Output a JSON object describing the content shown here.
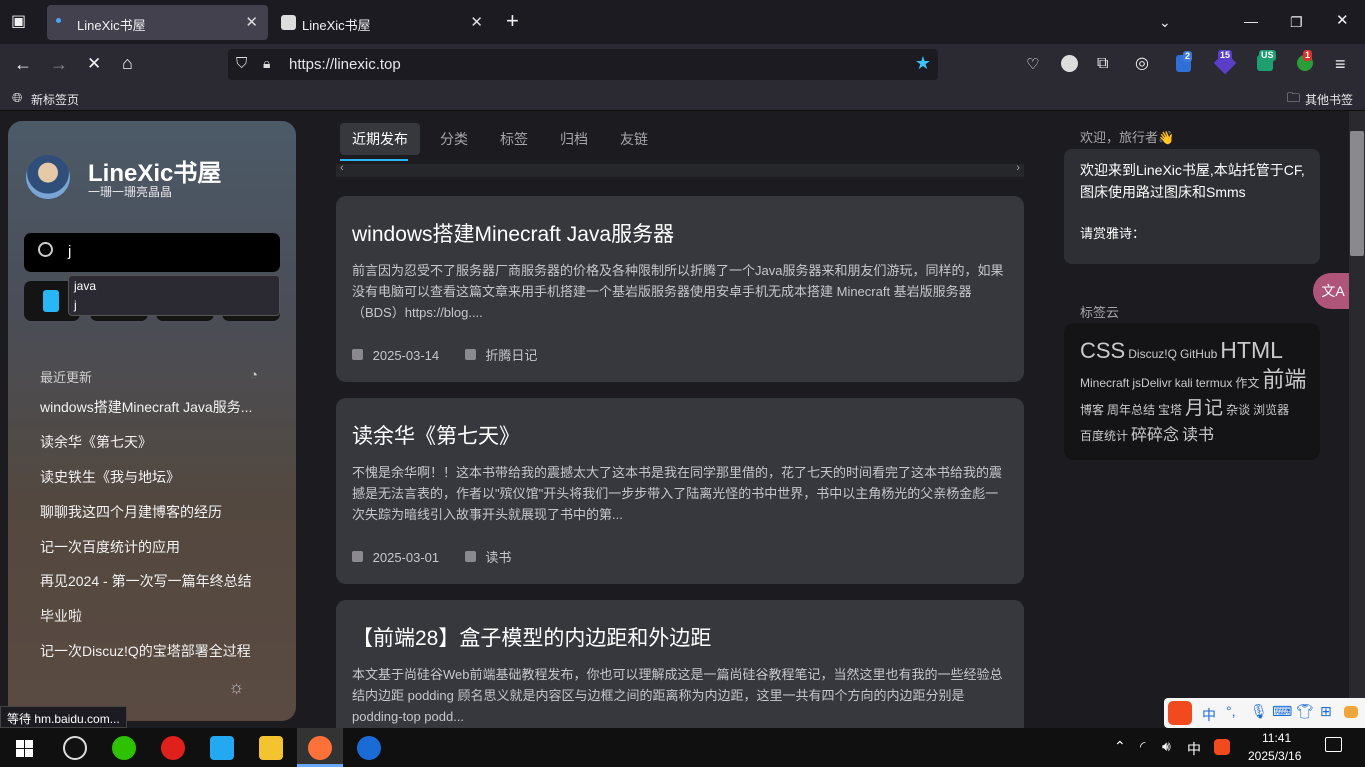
{
  "browser": {
    "tabs": [
      {
        "title": "LineXic书屋",
        "active": true
      },
      {
        "title": "LineXic书屋",
        "active": false
      }
    ],
    "new_tab": "+",
    "url": "https://linexic.top",
    "bookmarks": {
      "new_tab": "新标签页",
      "other": "其他书签"
    },
    "ext_badges": [
      "2",
      "15",
      "US",
      "1"
    ]
  },
  "sidebar": {
    "site_title": "LineXic书屋",
    "site_subtitle": "一珊一珊亮晶晶",
    "search_value": "j",
    "suggestions": [
      "java",
      "j"
    ],
    "recent_title": "最近更新",
    "recent_items": [
      "windows搭建Minecraft Java服务...",
      "读余华《第七天》",
      "读史铁生《我与地坛》",
      "聊聊我这四个月建博客的经历",
      "记一次百度统计的应用",
      "再见2024 - 第一次写一篇年终总结",
      "毕业啦",
      "记一次Discuz!Q的宝塔部署全过程"
    ]
  },
  "main": {
    "tabs": [
      "近期发布",
      "分类",
      "标签",
      "归档",
      "友链"
    ],
    "posts": [
      {
        "title": "windows搭建Minecraft Java服务器",
        "excerpt": "前言因为忍受不了服务器厂商服务器的价格及各种限制所以折腾了一个Java服务器来和朋友们游玩，同样的，如果没有电脑可以查看这篇文章来用手机搭建一个基岩版服务器使用安卓手机无成本搭建 Minecraft 基岩版服务器（BDS）https://blog....",
        "date": "2025-03-14",
        "category": "折腾日记"
      },
      {
        "title": "读余华《第七天》",
        "excerpt": "不愧是余华啊！！这本书带给我的震撼太大了这本书是我在同学那里借的，花了七天的时间看完了这本书给我的震撼是无法言表的，作者以\"殡仪馆\"开头将我们一步步带入了陆离光怪的书中世界，书中以主角杨光的父亲杨金彪一次失踪为暗线引入故事开头就展现了书中的第...",
        "date": "2025-03-01",
        "category": "读书"
      },
      {
        "title": "【前端28】盒子模型的内边距和外边距",
        "excerpt": "本文基于尚硅谷Web前端基础教程发布，你也可以理解成这是一篇尚硅谷教程笔记，当然这里也有我的一些经验总结内边距 podding 顾名思义就是内容区与边框之间的距离称为内边距，这里一共有四个方向的内边距分别是 podding-top podd..."
      }
    ]
  },
  "right": {
    "welcome_title": "欢迎，旅行者👋",
    "welcome_text": "欢迎来到LineXic书屋,本站托管于CF,图床使用路过图床和Smms",
    "poem_label": "请赏雅诗：",
    "tagcloud_title": "标签云",
    "tags": [
      {
        "name": "CSS",
        "size": 22
      },
      {
        "name": "Discuz!Q",
        "size": 12
      },
      {
        "name": "GitHub",
        "size": 12
      },
      {
        "name": "HTML",
        "size": 23
      },
      {
        "name": "Minecraft",
        "size": 12
      },
      {
        "name": "jsDelivr",
        "size": 12
      },
      {
        "name": "kali",
        "size": 12
      },
      {
        "name": "termux",
        "size": 12
      },
      {
        "name": "作文",
        "size": 12
      },
      {
        "name": "前端",
        "size": 22
      },
      {
        "name": "博客",
        "size": 12
      },
      {
        "name": "周年总结",
        "size": 12
      },
      {
        "name": "宝塔",
        "size": 12
      },
      {
        "name": "月记",
        "size": 19
      },
      {
        "name": "杂谈",
        "size": 12
      },
      {
        "name": "浏览器",
        "size": 12
      },
      {
        "name": "百度统计",
        "size": 12
      },
      {
        "name": "碎碎念",
        "size": 16
      },
      {
        "name": "读书",
        "size": 16
      }
    ],
    "translate_label": "文A"
  },
  "status": "等待 hm.baidu.com...",
  "taskbar": {
    "time": "11:41",
    "date": "2025/3/16",
    "ime_lang": "中",
    "ime_bar": "中"
  }
}
